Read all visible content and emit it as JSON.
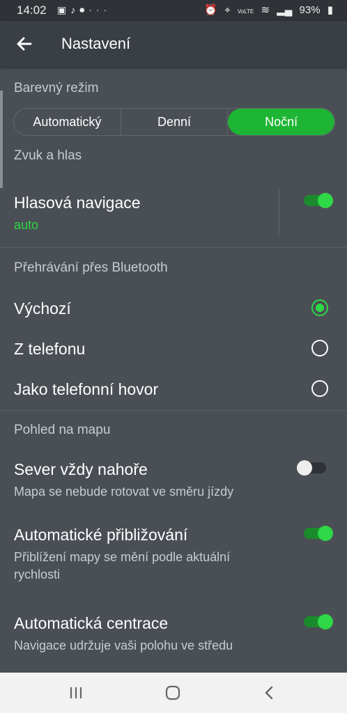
{
  "status_bar": {
    "time": "14:02",
    "left_icons": [
      "image-icon",
      "music-icon",
      "mic-icon",
      "more-icon"
    ],
    "right_icons": [
      "alarm-icon",
      "location-icon",
      "volte-icon",
      "wifi-icon",
      "signal-icon"
    ],
    "volte": "VoLTE",
    "battery": "93%"
  },
  "app_bar": {
    "title": "Nastavení"
  },
  "color_mode": {
    "header": "Barevný režim",
    "options": [
      "Automatický",
      "Denní",
      "Noční"
    ],
    "selected": "Noční"
  },
  "sound": {
    "header": "Zvuk a hlas",
    "voice_nav_title": "Hlasová navigace",
    "voice_nav_value": "auto",
    "voice_nav_enabled": true
  },
  "bluetooth": {
    "header": "Přehrávání přes Bluetooth",
    "options": [
      "Výchozí",
      "Z telefonu",
      "Jako telefonní hovor"
    ],
    "selected": "Výchozí"
  },
  "map_view": {
    "header": "Pohled na mapu",
    "north_up": {
      "title": "Sever vždy nahoře",
      "desc": "Mapa se nebude rotovat ve směru jízdy",
      "enabled": false
    },
    "auto_zoom": {
      "title": "Automatické přibližování",
      "desc_line1": "Přiblížení mapy se mění podle aktuální",
      "desc_line2": "rychlosti",
      "enabled": true
    },
    "auto_center": {
      "title": "Automatická centrace",
      "desc": "Navigace udržuje vaši polohu ve středu",
      "enabled": true
    }
  },
  "colors": {
    "accent": "#2ed846",
    "background": "#4a4f55",
    "app_bar": "#3a3f45"
  },
  "nav_bar": {
    "icons": [
      "recents-icon",
      "home-icon",
      "back-nav-icon"
    ]
  }
}
